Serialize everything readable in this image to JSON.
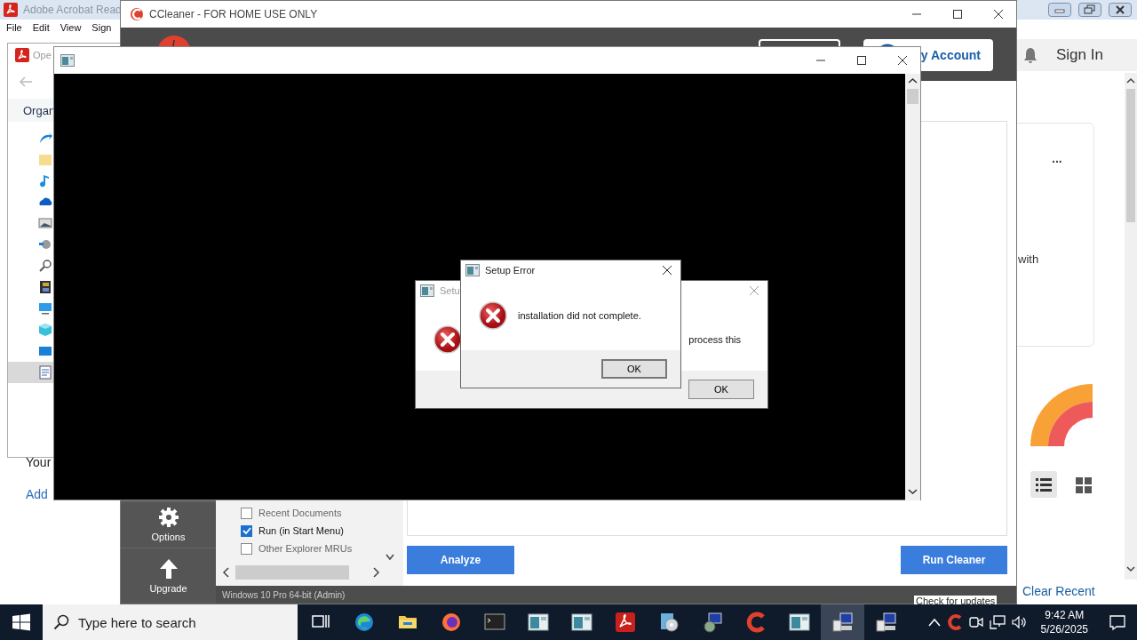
{
  "acrobat": {
    "title": "Adobe Acrobat Read",
    "menu": [
      "File",
      "Edit",
      "View",
      "Sign"
    ],
    "sign_in": "Sign In",
    "open_window": {
      "title": "Ope",
      "toolbar_label": "Organ",
      "nav_items": [
        {
          "kind": "arrow",
          "selected": false
        },
        {
          "kind": "folder",
          "selected": false
        },
        {
          "kind": "music",
          "selected": false
        },
        {
          "kind": "cloud",
          "selected": false
        },
        {
          "kind": "image",
          "selected": false
        },
        {
          "kind": "tools",
          "selected": false
        },
        {
          "kind": "search",
          "selected": false
        },
        {
          "kind": "film",
          "selected": false
        },
        {
          "kind": "monitor",
          "selected": false
        },
        {
          "kind": "cube",
          "selected": false
        },
        {
          "kind": "desktop",
          "selected": false
        },
        {
          "kind": "document",
          "selected": true
        }
      ]
    },
    "text_1": "Your",
    "link": "Add",
    "card_text": "with",
    "more": "...",
    "clear_recent": "Clear Recent",
    "view_modes": [
      {
        "kind": "list",
        "selected": true
      },
      {
        "kind": "grid",
        "selected": false
      }
    ]
  },
  "ccleaner": {
    "title": "CCleaner - FOR HOME USE ONLY",
    "account_button": "y Account",
    "nav": [
      {
        "kind": "gear",
        "label": "Options"
      },
      {
        "kind": "upgrade",
        "label": "Upgrade"
      }
    ],
    "items": [
      {
        "label": "Recent Documents",
        "checked": false
      },
      {
        "label": "Run (in Start Menu)",
        "checked": true
      },
      {
        "label": "Other Explorer MRUs",
        "checked": false
      }
    ],
    "analyze": "Analyze",
    "run_cleaner": "Run Cleaner",
    "status": "Windows 10 Pro 64-bit (Admin)",
    "check_updates": "Check for updates"
  },
  "dialogs": [
    {
      "title": "Setu",
      "message": "process this",
      "button": "OK"
    },
    {
      "title": "Setup Error",
      "message": "installation did not complete.",
      "button": "OK"
    }
  ],
  "taskbar": {
    "search_placeholder": "Type here to search",
    "apps": [
      {
        "kind": "taskview",
        "selected": false
      },
      {
        "kind": "edge",
        "selected": false
      },
      {
        "kind": "explorer",
        "selected": false
      },
      {
        "kind": "firefox",
        "selected": false
      },
      {
        "kind": "terminal",
        "selected": false
      },
      {
        "kind": "window",
        "selected": false
      },
      {
        "kind": "window",
        "selected": false
      },
      {
        "kind": "acrobat",
        "selected": false
      },
      {
        "kind": "installer",
        "selected": false
      },
      {
        "kind": "setup",
        "selected": false
      },
      {
        "kind": "ccleaner",
        "selected": false
      },
      {
        "kind": "window",
        "selected": false
      },
      {
        "kind": "computer",
        "selected": true
      },
      {
        "kind": "computer",
        "selected": false
      }
    ],
    "time": "9:42 AM",
    "date": "5/26/2025"
  }
}
